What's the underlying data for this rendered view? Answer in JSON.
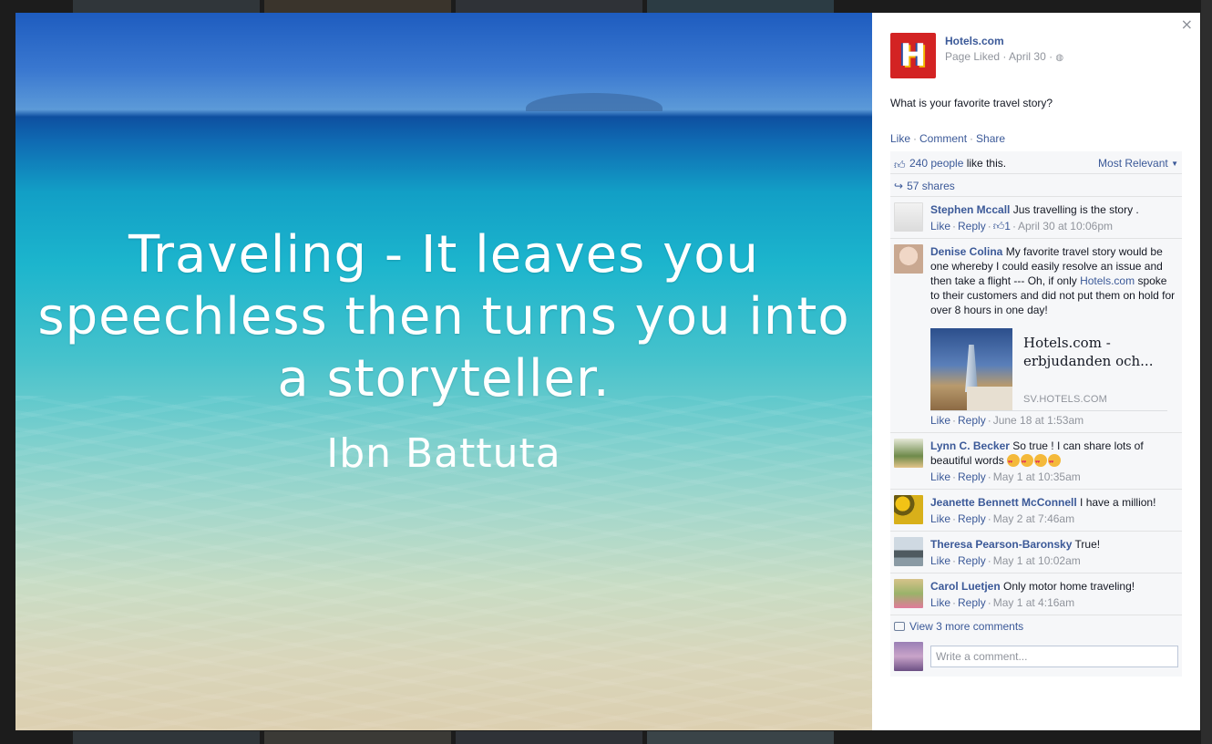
{
  "photo": {
    "quote": "Traveling - It leaves you speechless then turns you into a storyteller.",
    "author": "Ibn Battuta"
  },
  "panel": {
    "close_label": "×",
    "page_name": "Hotels.com",
    "page_sub": "Page Liked · April 30 ·",
    "post_text": "What is your favorite travel story?",
    "actions": {
      "like": "Like",
      "comment": "Comment",
      "share": "Share"
    },
    "likes": {
      "people": "240 people",
      "suffix": " like this.",
      "sort": "Most Relevant"
    },
    "shares": "57 shares",
    "comments": [
      {
        "name": "Stephen Mccall",
        "text": " Jus travelling is the story .",
        "like": "Like",
        "reply": "Reply",
        "like_count": "1",
        "time": "April 30 at 10:06pm"
      },
      {
        "name": "Denise Colina",
        "text_before": " My favorite travel story would be one whereby I could easily resolve an issue and then take a flight --- Oh, if only ",
        "link": "Hotels.com",
        "text_after": " spoke to their customers and did not put them on hold for over 8 hours in one day!",
        "attach_title": "Hotels.com - erbjudanden och...",
        "attach_domain": "SV.HOTELS.COM",
        "like": "Like",
        "reply": "Reply",
        "time": "June 18 at 1:53am"
      },
      {
        "name": "Lynn C. Becker",
        "text": " So true ! I can share lots of beautiful words ",
        "like": "Like",
        "reply": "Reply",
        "time": "May 1 at 10:35am"
      },
      {
        "name": "Jeanette Bennett McConnell",
        "text": " I have a million!",
        "like": "Like",
        "reply": "Reply",
        "time": "May 2 at 7:46am"
      },
      {
        "name": "Theresa Pearson-Baronsky",
        "text": " True!",
        "like": "Like",
        "reply": "Reply",
        "time": "May 1 at 10:02am"
      },
      {
        "name": "Carol Luetjen",
        "text": " Only motor home traveling!",
        "like": "Like",
        "reply": "Reply",
        "time": "May 1 at 4:16am"
      }
    ],
    "view_more": "View 3 more comments",
    "write_placeholder": "Write a comment..."
  },
  "colors": {
    "link": "#3b5998",
    "meta": "#90949c",
    "brand_red": "#d32323"
  }
}
